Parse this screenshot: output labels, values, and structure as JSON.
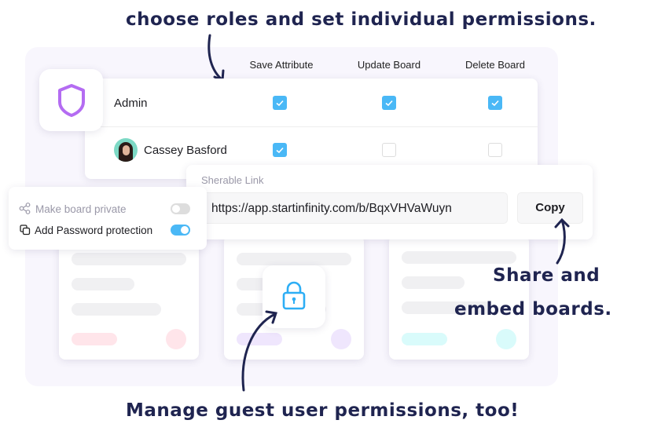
{
  "annotations": {
    "top": "choose roles and set individual permissions.",
    "share_line1": "Share and",
    "share_line2": "embed boards.",
    "bottom": "Manage guest user permissions, too!"
  },
  "permissions": {
    "columns": [
      "Save Attribute",
      "Update Board",
      "Delete Board"
    ],
    "rows": [
      {
        "name": "Admin",
        "icon": "shield-icon",
        "checks": [
          true,
          true,
          true
        ]
      },
      {
        "name": "Cassey Basford",
        "icon": "avatar",
        "checks": [
          true,
          false,
          false
        ]
      }
    ]
  },
  "share": {
    "label": "Sherable Link",
    "url": "https://app.startinfinity.com/b/BqxVHVaWuyn",
    "copy_label": "Copy"
  },
  "privacy": {
    "items": [
      {
        "label": "Make board private",
        "icon": "share-nodes-icon",
        "enabled": false
      },
      {
        "label": "Add Password protection",
        "icon": "copy-icon",
        "enabled": true
      }
    ]
  },
  "colors": {
    "accent": "#4ab8f6",
    "shield": "#b46cf2",
    "annotation": "#1f2450",
    "panel": "#f8f6fd"
  }
}
